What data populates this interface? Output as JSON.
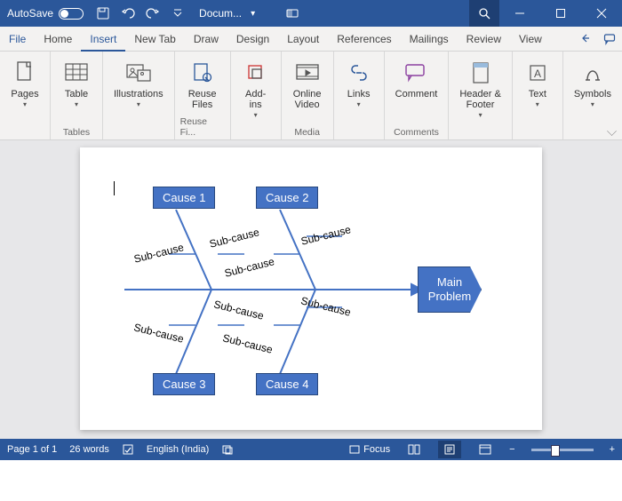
{
  "titlebar": {
    "autosave_label": "AutoSave",
    "document_name": "Docum...",
    "doc_chevron": "▾"
  },
  "tabs": {
    "file": "File",
    "home": "Home",
    "insert": "Insert",
    "newtab": "New Tab",
    "draw": "Draw",
    "design": "Design",
    "layout": "Layout",
    "references": "References",
    "mailings": "Mailings",
    "review": "Review",
    "view": "View"
  },
  "ribbon": {
    "pages_label": "Pages",
    "tables_label": "Tables",
    "table_btn": "Table",
    "illustrations_btn": "Illustrations",
    "reuse_files_btn": "Reuse\nFiles",
    "reuse_files_group": "Reuse Fi...",
    "addins_btn": "Add-\nins",
    "online_video_btn": "Online\nVideo",
    "media_group": "Media",
    "links_btn": "Links",
    "comment_btn": "Comment",
    "comments_group": "Comments",
    "header_footer_btn": "Header &\nFooter",
    "text_btn": "Text",
    "symbols_btn": "Symbols"
  },
  "fishbone": {
    "cause1": "Cause 1",
    "cause2": "Cause 2",
    "cause3": "Cause 3",
    "cause4": "Cause 4",
    "sc_label": "Sub-cause",
    "main": "Main\nProblem"
  },
  "status": {
    "page_info": "Page 1 of 1",
    "words": "26 words",
    "language": "English (India)",
    "focus": "Focus",
    "zoom_minus": "−",
    "zoom_plus": "+"
  }
}
